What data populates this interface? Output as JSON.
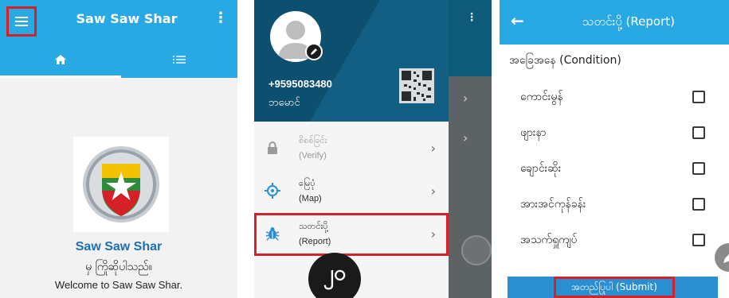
{
  "screen1": {
    "title": "Saw Saw Shar",
    "overflow_glyph": "⋮",
    "tabs": [
      {
        "icon": "home-icon"
      },
      {
        "icon": "list-icon"
      }
    ],
    "app_name": "Saw Saw Shar",
    "welcome_mm": "မှ ကြိုဆိုပါသည်။",
    "welcome_en": "Welcome to Saw Saw Shar.",
    "colors": {
      "accent": "#29a9e3",
      "highlight": "#d2232a",
      "brand_text": "#1d6fb5"
    }
  },
  "screen2": {
    "phone": "+9595083480",
    "name": "ဘမောင်",
    "menu": [
      {
        "label_mm": "စိစစ်ခြင်း",
        "label_en": "(Verify)",
        "icon": "lock-icon",
        "chevron": "›"
      },
      {
        "label_mm": "မြေပုံ",
        "label_en": "(Map)",
        "icon": "location-icon",
        "chevron": "›"
      },
      {
        "label_mm": "သတင်းပို့",
        "label_en": "(Report)",
        "icon": "bug-icon",
        "chevron": "›"
      }
    ],
    "step_marker": "၂၀",
    "side_glyphs": {
      "dots": "⋮",
      "chevron": "›"
    }
  },
  "screen3": {
    "back_glyph": "←",
    "title": "သတင်းပို့ (Report)",
    "section_title": "အခြေအနေ (Condition)",
    "conditions": [
      {
        "label": "ကောင်းမွန်",
        "checked": false
      },
      {
        "label": "ဖျားနာ",
        "checked": false
      },
      {
        "label": "ချောင်းဆိုး",
        "checked": false
      },
      {
        "label": "အားအင်ကုန်ခန်း",
        "checked": false
      },
      {
        "label": "အသက်ရှူကျပ်",
        "checked": false
      }
    ],
    "submit_label": "အတည်ပြုပါ (Submit)"
  }
}
